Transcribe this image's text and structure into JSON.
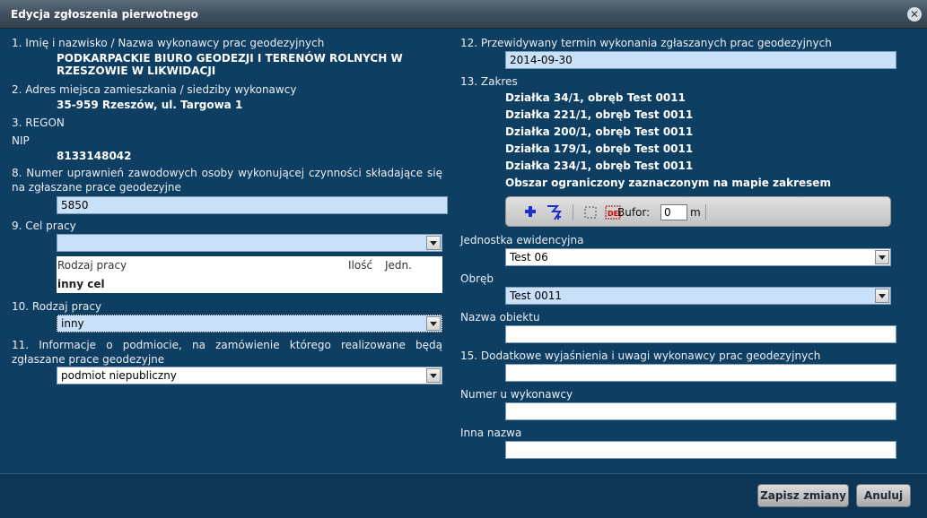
{
  "window": {
    "title": "Edycja zgłoszenia pierwotnego"
  },
  "left": {
    "f1_label": "1. Imię i nazwisko / Nazwa wykonawcy prac geodezyjnych",
    "f1_value": "PODKARPACKIE BIURO GEODEZJI I TERENÓW ROLNYCH W RZESZOWIE W LIKWIDACJI",
    "f2_label": "2. Adres miejsca zamieszkania / siedziby wykonawcy",
    "f2_value": "35-959 Rzeszów, ul. Targowa 1",
    "f3_label": "3. REGON",
    "nip_label": "NIP",
    "nip_value": "8133148042",
    "f8_label": "8. Numer uprawnień zawodowych osoby wykonującej czynności składające się na zgłaszane prace geodezyjne",
    "f8_value": "5850",
    "f9_label": "9. Cel pracy",
    "f9_value": "",
    "table": {
      "col_type": "Rodzaj pracy",
      "col_qty": "Ilość",
      "col_unit": "Jedn.",
      "row_value": "inny cel"
    },
    "f10_label": "10. Rodzaj pracy",
    "f10_value": "inny",
    "f11_label": "11. Informacje o podmiocie, na zamówienie którego realizowane będą zgłaszane prace geodezyjne",
    "f11_value": "podmiot niepubliczny"
  },
  "right": {
    "f12_label": "12. Przewidywany termin wykonania zgłaszanych prac geodezyjnych",
    "f12_value": "2014-09-30",
    "f13_label": "13. Zakres",
    "scope_items": [
      "Działka 34/1, obręb Test 0011",
      "Działka 221/1, obręb Test 0011",
      "Działka 200/1, obręb Test 0011",
      "Działka 179/1, obręb Test 0011",
      "Działka 234/1, obręb Test 0011",
      "Obszar ograniczony zaznaczonym na mapie zakresem"
    ],
    "toolbar": {
      "buffer_label": "Bufor:",
      "buffer_value": "0",
      "buffer_unit": "m",
      "del_icon_text": "DEL"
    },
    "unit_label": "Jednostka ewidencyjna",
    "unit_value": "Test 06",
    "precinct_label": "Obręb",
    "precinct_value": "Test 0011",
    "object_label": "Nazwa obiektu",
    "object_value": "",
    "f15_label": "15. Dodatkowe wyjaśnienia i uwagi wykonawcy prac geodezyjnych",
    "f15_value": "",
    "contractor_no_label": "Numer u wykonawcy",
    "contractor_no_value": "",
    "other_name_label": "Inna nazwa",
    "other_name_value": ""
  },
  "footer": {
    "save_label": "Zapisz zmiany",
    "cancel_label": "Anuluj"
  },
  "colors": {
    "background": "#0f3e63",
    "input_blue": "#c8e0f8",
    "accent_icon": "#1a2fd0"
  }
}
